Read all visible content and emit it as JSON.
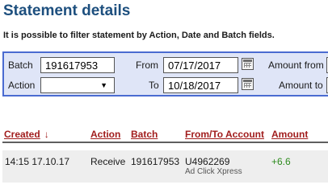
{
  "page": {
    "title": "Statement details",
    "subtitle": "It is possible to filter statement by Action, Date and Batch fields."
  },
  "filters": {
    "batch_label": "Batch",
    "batch_value": "191617953",
    "action_label": "Action",
    "action_value": "",
    "from_label": "From",
    "from_value": "07/17/2017",
    "to_label": "To",
    "to_value": "10/18/2017",
    "amount_from_label": "Amount from",
    "amount_from_value": "",
    "amount_to_label": "Amount to",
    "amount_to_value": ""
  },
  "table": {
    "columns": [
      "Created",
      "Action",
      "Batch",
      "From/To Account",
      "Amount"
    ],
    "sort_indicator": "↓",
    "rows": [
      {
        "created": "14:15 17.10.17",
        "action": "Receive",
        "batch": "191617953",
        "account": "U4962269",
        "account_name": "Ad Click Xpress",
        "amount": "+6.6"
      }
    ]
  },
  "colors": {
    "title": "#1d4f7e",
    "panel_bg": "#dfe5f7",
    "panel_border": "#4a6bd1",
    "header_link": "#a11d1d",
    "amount_positive": "#2e8b1e"
  },
  "icons": {
    "calendar": "calendar-icon",
    "dropdown": "chevron-down-icon"
  }
}
